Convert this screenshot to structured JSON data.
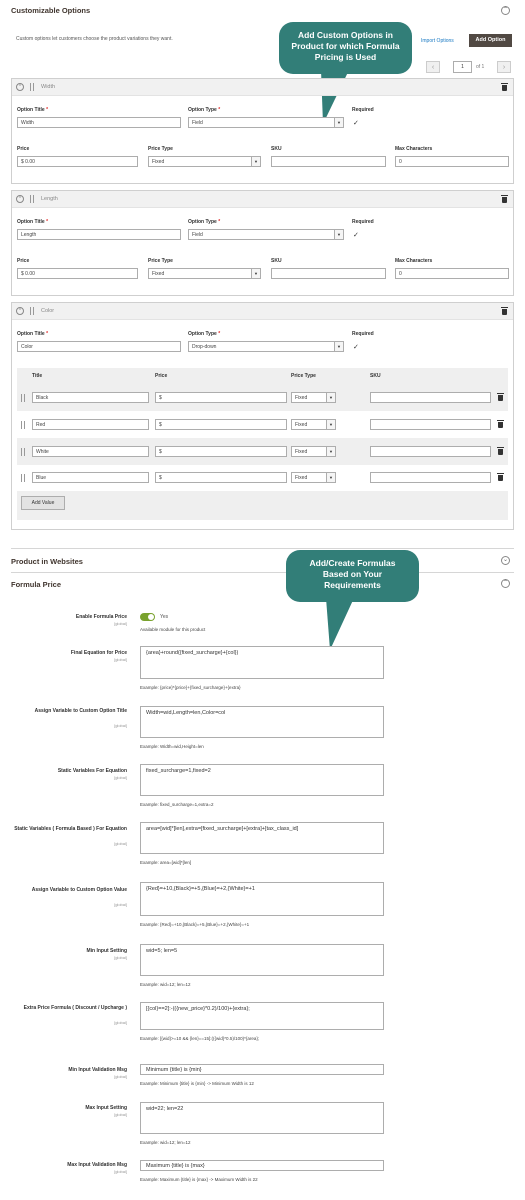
{
  "custom_options": {
    "title": "Customizable Options",
    "description": "Custom options let customers choose the product variations they want.",
    "import_label": "Import Options",
    "add_label": "Add Option",
    "page_value": "1",
    "page_of": "of 1",
    "callout": "Add Custom Options in Product for which Formula Pricing is Used"
  },
  "labels": {
    "option_title": "Option Title",
    "option_type": "Option Type",
    "required": "Required",
    "price": "Price",
    "price_type": "Price Type",
    "sku": "SKU",
    "max_chars": "Max Characters",
    "star": "*",
    "col_title": "Title",
    "col_price": "Price",
    "col_price_type": "Price Type",
    "col_sku": "SKU",
    "add_value": "Add Value"
  },
  "options": [
    {
      "name": "Width",
      "title": "Width",
      "type": "Field",
      "price": "0.00",
      "price_type": "Fixed",
      "sku": "",
      "max_chars": "0",
      "currency": "$"
    },
    {
      "name": "Length",
      "title": "Length",
      "type": "Field",
      "price": "0.00",
      "price_type": "Fixed",
      "sku": "",
      "max_chars": "0",
      "currency": "$"
    },
    {
      "name": "Color",
      "title": "Color",
      "type": "Drop-down"
    }
  ],
  "color_values": [
    {
      "title": "Black",
      "price": "$",
      "price_type": "Fixed"
    },
    {
      "title": "Red",
      "price": "$",
      "price_type": "Fixed"
    },
    {
      "title": "White",
      "price": "$",
      "price_type": "Fixed"
    },
    {
      "title": "Blue",
      "price": "$",
      "price_type": "Fixed"
    }
  ],
  "websites": {
    "title": "Product in Websites"
  },
  "formula": {
    "title": "Formula Price",
    "callout": "Add/Create Formulas Based on Your Requirements",
    "scope": "[global]",
    "enable_label": "Enable Formula Price",
    "enable_value": "Yes",
    "enable_note": "Available module for this product",
    "fields": [
      {
        "label": "Final Equation for Price",
        "value": "{area}+round({fixed_surcharge}+{col})",
        "example": "Example: {price}*{price}+{fixed_surcharge}+{extra}"
      },
      {
        "label": "Assign Variable to Custom Option Title",
        "value": "Width=wid,Length=len,Color=col",
        "example": "Example: Width=wid,Height=len"
      },
      {
        "label": "Static Variables For Equation",
        "value": "fixed_surcharge=1,fixed=2",
        "example": "Example: fixed_surcharge=1,extra=2"
      },
      {
        "label": "Static Variables ( Formula Based ) For Equation",
        "value": "area=[wid]*[len],extra=[fixed_surcharge]+[extra]+[tax_class_id]",
        "example": "Example: area=[wid]*[len]"
      },
      {
        "label": "Assign Variable to Custom Option Value",
        "value": "{Red}=+10,{Black}=+5,{Blue}=+2,{White}=+1",
        "example": "Example: {Red}=+10,{Black}=+5,{Blue}=+2,{White}=+1"
      },
      {
        "label": "Min Input Setting",
        "value": "wid=5; len=5",
        "example": "Example: wid=12; len=12"
      },
      {
        "label": "Extra Price Formula ( Discount / Upcharge )",
        "value": "[{col}==2]:-(({new_price}*0.2)/100)+{extra};",
        "example": "Example: [{wid}>=10 && {len}==15]:(({wid}*0.5)/100)*{area};"
      },
      {
        "label": "Min Input Validation Msg",
        "value": "Minimum {title} is {min}",
        "example": "Example: Minimum {title} is {min} -> Minimum Width is 12"
      },
      {
        "label": "Max Input Setting",
        "value": "wid=22; len=22",
        "example": "Example: wid=12; len=12"
      },
      {
        "label": "Max Input Validation Msg",
        "value": "Maximum {title} is {max}",
        "example": "Example: Maximum {title} is {max} -> Maximum Width is 22"
      }
    ]
  },
  "colors": {
    "accent": "#327e78",
    "toggle": "#79a22e",
    "required": "#e22626",
    "button": "#514943"
  },
  "icons": [
    "chevron-up-icon",
    "chevron-down-icon",
    "trash-icon",
    "drag-handle-icon",
    "checkmark-icon",
    "arrow-down-icon"
  ]
}
